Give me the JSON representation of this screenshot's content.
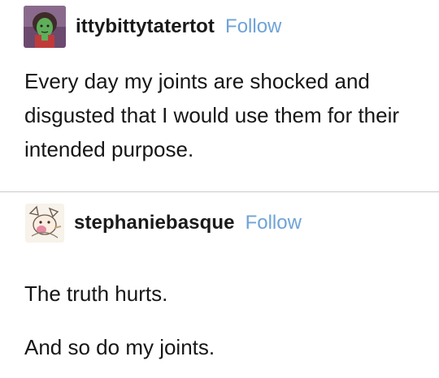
{
  "posts": [
    {
      "username": "ittybittytatertot",
      "follow_label": "Follow",
      "avatar_icon": "green-character-avatar-icon",
      "paragraphs": [
        "Every day my joints are shocked and disgusted that I would use them for their intended purpose."
      ]
    },
    {
      "username": "stephaniebasque",
      "follow_label": "Follow",
      "avatar_icon": "cartoon-sketch-avatar-icon",
      "paragraphs": [
        "The truth hurts.",
        "And so do my joints."
      ]
    }
  ],
  "colors": {
    "follow_link": "#6fa3d6",
    "divider": "#c9c9c9",
    "text": "#161616"
  }
}
